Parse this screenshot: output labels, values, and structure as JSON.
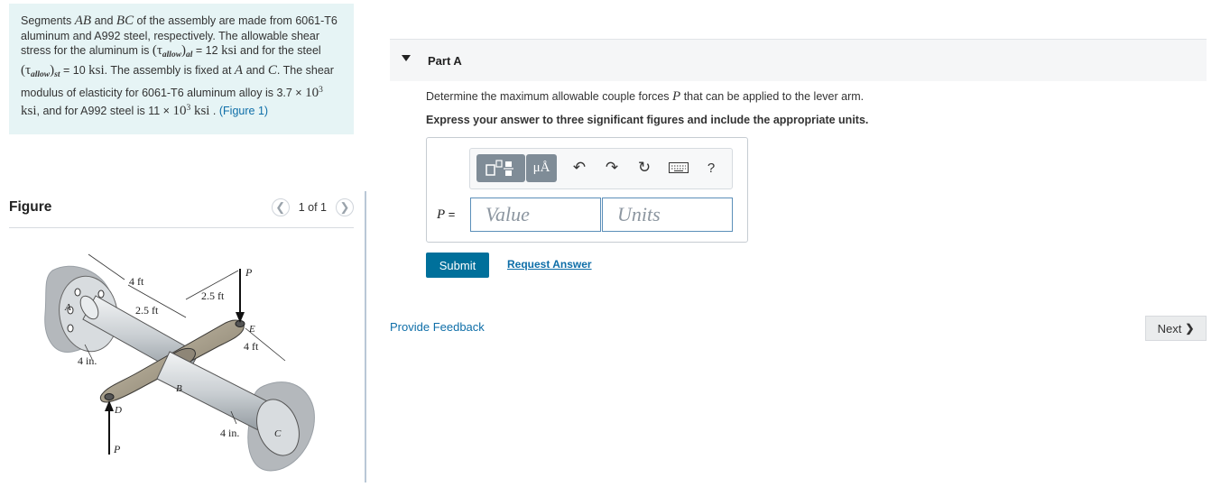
{
  "problem": {
    "seg1": "Segments ",
    "ab": "AB",
    "and1": " and ",
    "bc": "BC",
    "seg2": " of the assembly are made from 6061-T6 aluminum and A992 steel, respectively. The allowable shear stress for the aluminum is ",
    "tau1": "(τ",
    "sub1": "allow",
    "tail1": ")",
    "sub1b": "al",
    "eq1": " = 12 ",
    "ksi1": "ksi",
    "mid1": " and for the steel ",
    "tau2": "(τ",
    "sub2": "allow",
    "tail2": ")",
    "sub2b": "st",
    "eq2": " = 10 ",
    "ksi2": "ksi",
    "mid2": ". The assembly is fixed at ",
    "a": "A",
    "and2": " and ",
    "c": "C",
    "mid3": ". The shear modulus of elasticity for 6061-T6 aluminum alloy is 3.7 × ",
    "ten1": "10",
    "exp1": "3",
    "ksi3": " ksi",
    "mid4": ", and for A992 steel is 11 × ",
    "ten2": "10",
    "exp2": "3",
    "ksi4": " ksi",
    "mid5": " . ",
    "figure_link": "(Figure 1)"
  },
  "figure_panel": {
    "title": "Figure",
    "pager_text": "1 of 1",
    "prev_icon": "chevron-left-icon",
    "next_icon": "chevron-right-icon",
    "labels": {
      "d1": "4 ft",
      "d2": "2.5 ft",
      "d3": "2.5 ft",
      "d4": "4 ft",
      "d5": "4 in.",
      "d6": "4 in.",
      "pa": "A",
      "pb": "B",
      "pc": "C",
      "pd": "D",
      "pe": "E",
      "p1": "P",
      "p2": "P"
    }
  },
  "part": {
    "title": "Part A",
    "question_pre": "Determine the maximum allowable couple forces ",
    "question_var": "P",
    "question_post": " that can be applied to the lever arm.",
    "instruction": "Express your answer to three significant figures and include the appropriate units.",
    "var_label": "P",
    "eq": " =",
    "value_placeholder": "Value",
    "units_placeholder": "Units",
    "toolbar": {
      "units_label": "μÅ",
      "undo": "↶",
      "redo": "↷",
      "reset": "↻",
      "help": "?"
    },
    "submit_label": "Submit",
    "request_label": "Request Answer"
  },
  "footer": {
    "feedback_label": "Provide Feedback",
    "next_label": "Next",
    "next_icon": "❯"
  }
}
